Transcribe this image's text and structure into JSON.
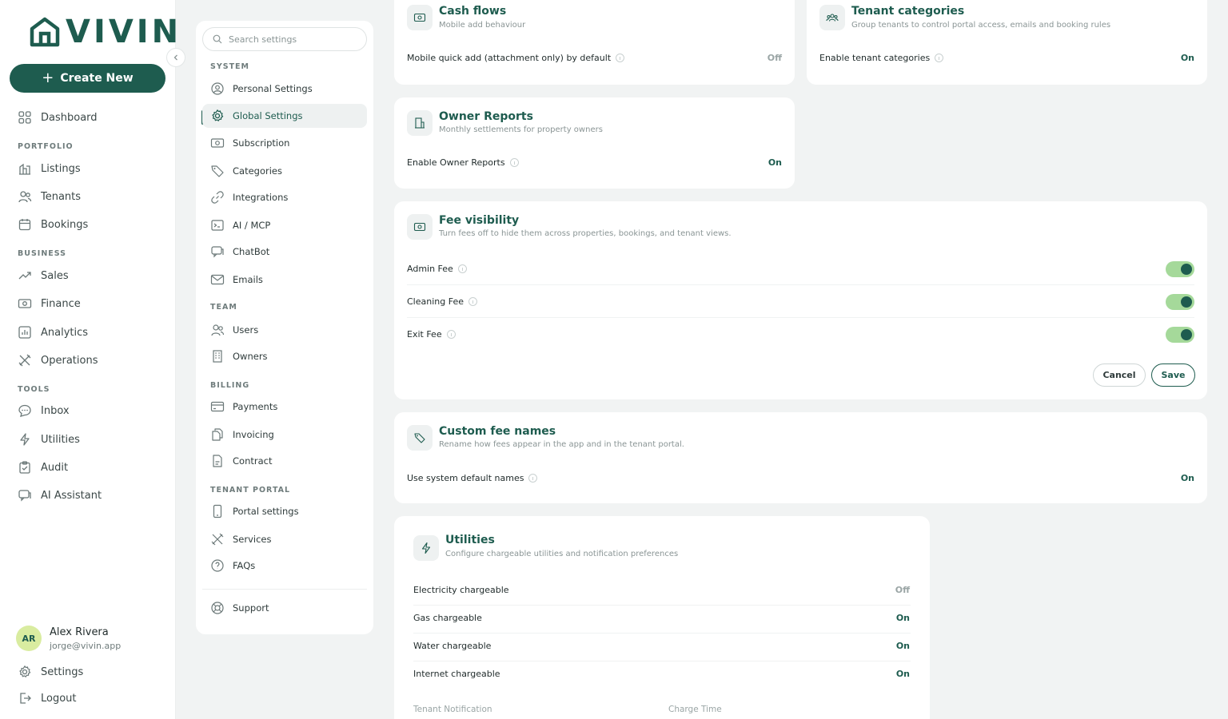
{
  "brand": {
    "name": "VIVIN",
    "color": "#1e5c4f"
  },
  "sidebar": {
    "create_label": "Create New",
    "dashboard": "Dashboard",
    "sections": {
      "portfolio": "PORTFOLIO",
      "business": "BUSINESS",
      "tools": "TOOLS"
    },
    "items": {
      "listings": "Listings",
      "tenants": "Tenants",
      "bookings": "Bookings",
      "sales": "Sales",
      "finance": "Finance",
      "analytics": "Analytics",
      "operations": "Operations",
      "inbox": "Inbox",
      "utilities": "Utilities",
      "audit": "Audit",
      "ai_assistant": "AI Assistant"
    },
    "user": {
      "initials": "AR",
      "name": "Alex Rivera",
      "email": "jorge@vivin.app"
    },
    "settings": "Settings",
    "logout": "Logout"
  },
  "settings_nav": {
    "search_placeholder": "Search settings",
    "system_head": "SYSTEM",
    "personal": "Personal Settings",
    "global": "Global Settings",
    "subscription": "Subscription",
    "categories": "Categories",
    "integrations": "Integrations",
    "ai_mcp": "AI / MCP",
    "chatbot": "ChatBot",
    "emails": "Emails",
    "team_head": "TEAM",
    "users": "Users",
    "owners": "Owners",
    "billing_head": "BILLING",
    "payments": "Payments",
    "invoicing": "Invoicing",
    "contract": "Contract",
    "portal_head": "TENANT PORTAL",
    "portal_settings": "Portal settings",
    "services": "Services",
    "faqs": "FAQs",
    "support": "Support"
  },
  "cards": {
    "cash_flows": {
      "title": "Cash flows",
      "subtitle": "Mobile add behaviour",
      "row_label": "Mobile quick add (attachment only) by default",
      "row_value": "Off"
    },
    "tenant_categories": {
      "title": "Tenant categories",
      "subtitle": "Group tenants to control portal access, emails and booking rules",
      "row_label": "Enable tenant categories",
      "row_value": "On"
    },
    "owner_reports": {
      "title": "Owner Reports",
      "subtitle": "Monthly settlements for property owners",
      "row_label": "Enable Owner Reports",
      "row_value": "On"
    },
    "fee_visibility": {
      "title": "Fee visibility",
      "subtitle": "Turn fees off to hide them across properties, bookings, and tenant views.",
      "fees": [
        {
          "label": "Admin Fee",
          "enabled": true
        },
        {
          "label": "Cleaning Fee",
          "enabled": true
        },
        {
          "label": "Exit Fee",
          "enabled": true
        }
      ],
      "cancel_label": "Cancel",
      "save_label": "Save"
    },
    "custom_fee_names": {
      "title": "Custom fee names",
      "subtitle": "Rename how fees appear in the app and in the tenant portal.",
      "row_label": "Use system default names",
      "row_value": "On"
    },
    "utilities": {
      "title": "Utilities",
      "subtitle": "Configure chargeable utilities and notification preferences",
      "rows": [
        {
          "label": "Electricity chargeable",
          "value": "Off"
        },
        {
          "label": "Gas chargeable",
          "value": "On"
        },
        {
          "label": "Water chargeable",
          "value": "On"
        },
        {
          "label": "Internet chargeable",
          "value": "On"
        }
      ],
      "col_notification": "Tenant Notification",
      "col_charge_time": "Charge Time"
    }
  }
}
